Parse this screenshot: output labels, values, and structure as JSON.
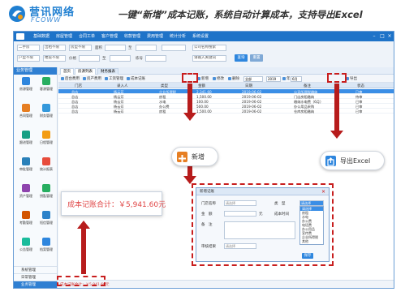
{
  "brand": {
    "name_cn": "营讯网络",
    "name_en": "FCOWW",
    "colors": {
      "primary": "#1f7fd1",
      "accent_red": "#c81e1e",
      "sum_red": "#e04545"
    }
  },
  "headline": "一键“新增”成本记账，系统自动计算成本，支持导出Excel",
  "menubar": {
    "items": [
      "基础数据",
      "房屋管理",
      "合同工单",
      "客户管理",
      "收款管理",
      "费用管理",
      "统计分析",
      "系统设置"
    ]
  },
  "filters": {
    "row1": [
      {
        "value": "二手房"
      },
      {
        "value": "出租不限"
      },
      {
        "value": "房型不限"
      },
      {
        "value": "面积"
      },
      {
        "value": "至"
      },
      {
        "value": "公司名称搜索"
      }
    ],
    "row2": [
      {
        "value": "户型不限"
      },
      {
        "value": "楼层不限"
      },
      {
        "value": "价格"
      },
      {
        "value": "至"
      },
      {
        "value": "栋号"
      },
      {
        "value": "请输入关键词"
      }
    ],
    "query_label": "查询",
    "reset_label": "重置"
  },
  "sidebar": {
    "title": "业务管理",
    "modules": [
      {
        "label": "房源管理",
        "icon": "house-icon",
        "color": "#2e86de"
      },
      {
        "label": "客源管理",
        "icon": "people-icon",
        "color": "#27ae60"
      },
      {
        "label": "合同管理",
        "icon": "contract-icon",
        "color": "#e67e22"
      },
      {
        "label": "财务管理",
        "icon": "finance-icon",
        "color": "#3498db"
      },
      {
        "label": "跟进管理",
        "icon": "followup-icon",
        "color": "#16a085"
      },
      {
        "label": "日程管理",
        "icon": "calendar-icon",
        "color": "#f39c12"
      },
      {
        "label": "审批管理",
        "icon": "approve-icon",
        "color": "#2980b9"
      },
      {
        "label": "统计报表",
        "icon": "chart-icon",
        "color": "#e74c3c"
      },
      {
        "label": "资产管理",
        "icon": "asset-icon",
        "color": "#8e44ad"
      },
      {
        "label": "钥匙管理",
        "icon": "key-icon",
        "color": "#27ae60"
      },
      {
        "label": "考勤管理",
        "icon": "clock-icon",
        "color": "#d35400"
      },
      {
        "label": "短信管理",
        "icon": "sms-icon",
        "color": "#2c82c9"
      },
      {
        "label": "公告管理",
        "icon": "notice-icon",
        "color": "#1abc9c"
      },
      {
        "label": "档案管理",
        "icon": "archive-icon",
        "color": "#2e86de"
      }
    ],
    "footer": [
      "系统管理",
      "日常管理",
      "业务管理"
    ]
  },
  "tabs": [
    "首页",
    "房源列表",
    "财务报表"
  ],
  "toolbar": {
    "buttons": [
      "后台费用",
      "房产费用",
      "工资管理",
      "成本记账",
      "新增",
      "修改",
      "删除",
      "导出"
    ],
    "year": "2019",
    "year_label": "年",
    "month": "6月",
    "type_select": "全部"
  },
  "table": {
    "columns": [
      "门店",
      "录入人",
      "类型",
      "金额",
      "日期",
      "备注",
      "状态"
    ],
    "rows": [
      {
        "store": "总店",
        "person": "杨云芳",
        "type": "企业所得税",
        "amount": "2,341.60",
        "date": "2019-06-02",
        "note": "公司所得税缴纳",
        "status": "已审"
      },
      {
        "store": "总店",
        "person": "杨云芳",
        "type": "房租",
        "amount": "1,500.00",
        "date": "2019-06-02",
        "note": "门店房租缴纳",
        "status": "待审"
      },
      {
        "store": "总店",
        "person": "杨云芳",
        "type": "水电",
        "amount": "100.00",
        "date": "2019-06-02",
        "note": "缴纳水电费（6月）",
        "status": "已审"
      },
      {
        "store": "总店",
        "person": "杨云芳",
        "type": "办公费",
        "amount": "500.00",
        "date": "2019-06-02",
        "note": "办公用品采购",
        "status": "已审"
      },
      {
        "store": "总店",
        "person": "杨云芳",
        "type": "房租",
        "amount": "1,500.00",
        "date": "2019-06-02",
        "note": "仓库房租缴纳",
        "status": "已审"
      }
    ]
  },
  "status_bar": {
    "sum_text": "成本记账合计：￥5,941.60元"
  },
  "callouts": {
    "add_label": "新增",
    "export_label": "导出Excel",
    "sum_label": "成本记账合计：￥5,941.60元"
  },
  "dialog": {
    "title": "新增记账",
    "store_label": "门店名称",
    "store_value": "请选择",
    "type_label": "类　型",
    "type_value": "请选择",
    "amount_label": "金　额",
    "amount_unit": "元",
    "date_label": "成本时间",
    "note_label": "备　注",
    "audit_label": "审核结果",
    "audit_value": "请选择",
    "options": [
      "请选择",
      "房租",
      "水电",
      "办公费",
      "电话费",
      "办公用品",
      "宣传费",
      "企业所得税",
      "其他"
    ],
    "save_label": "保存"
  }
}
